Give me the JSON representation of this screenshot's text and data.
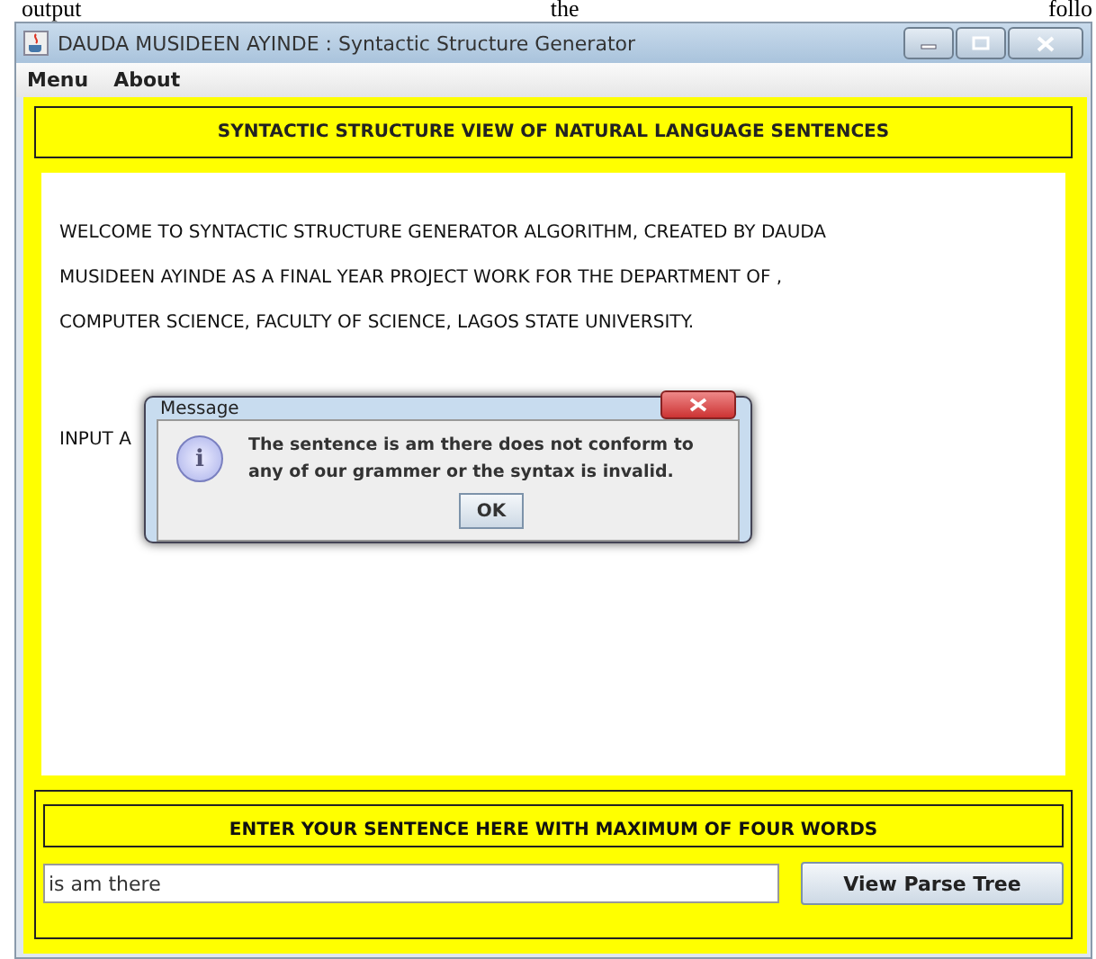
{
  "page_text": [
    "output",
    "the",
    "follo"
  ],
  "window": {
    "title": "DAUDA MUSIDEEN AYINDE : Syntactic Structure Generator"
  },
  "menu": [
    "Menu",
    "About"
  ],
  "header": "SYNTACTIC STRUCTURE VIEW OF NATURAL LANGUAGE SENTENCES",
  "output_lines": [
    "WELCOME TO SYNTACTIC STRUCTURE GENERATOR ALGORITHM, CREATED BY DAUDA",
    "MUSIDEEN AYINDE AS A FINAL YEAR PROJECT WORK FOR THE DEPARTMENT OF ,",
    "COMPUTER SCIENCE, FACULTY OF SCIENCE, LAGOS STATE UNIVERSITY.",
    "INPUT A"
  ],
  "input_section": {
    "label": "ENTER YOUR SENTENCE HERE WITH MAXIMUM OF FOUR WORDS",
    "value": "is am there",
    "button": "View Parse Tree"
  },
  "dialog": {
    "title": "Message",
    "icon": "i",
    "message": "The sentence is am there does not conform to any of our grammer or the syntax is invalid.",
    "button": "OK"
  }
}
